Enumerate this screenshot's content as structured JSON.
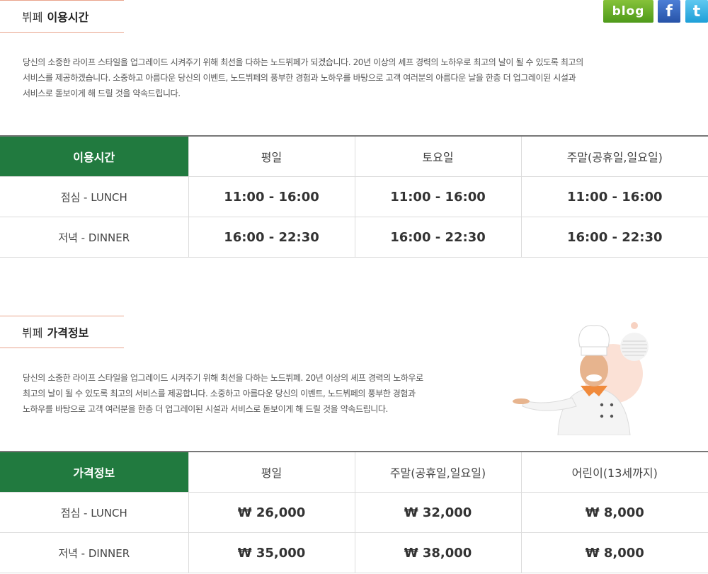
{
  "social": {
    "blog_label": "blog",
    "facebook_label": "f",
    "twitter_label": "t"
  },
  "hours_section": {
    "title_prefix": "뷔페",
    "title_bold": "이용시간",
    "description": [
      "당신의 소중한 라이프 스타일을 업그레이드 시켜주기 위해 최선을 다하는 노드뷔페가 되겠습니다. 20년 이상의 셰프 경력의 노하우로 최고의 날이 될 수 있도록 최고의",
      "서비스를 제공하겠습니다. 소중하고 아름다운 당신의 이벤트, 노드뷔페의 풍부한 경험과 노하우를 바탕으로 고객 여러분의 아름다운 날을 한층 더 업그레이된 시설과",
      "서비스로 돋보이게 해 드릴 것을 약속드립니다."
    ],
    "table": {
      "headers": [
        "이용시간",
        "평일",
        "토요일",
        "주말(공휴일,일요일)"
      ],
      "rows": [
        {
          "label": "점심 - LUNCH",
          "values": [
            "11:00 - 16:00",
            "11:00 - 16:00",
            "11:00 - 16:00"
          ]
        },
        {
          "label": "저녁 - DINNER",
          "values": [
            "16:00 - 22:30",
            "16:00 - 22:30",
            "16:00 - 22:30"
          ]
        }
      ]
    }
  },
  "price_section": {
    "title_prefix": "뷔페",
    "title_bold": "가격정보",
    "description": [
      "당신의 소중한 라이프 스타일을 업그레이드 시켜주기 위해 최선을 다하는 노드뷔페. 20년 이상의 셰프 경력의 노하우로",
      "최고의 날이 될 수 있도록 최고의 서비스를 제공합니다. 소중하고 아름다운 당신의 이벤트, 노드뷔페의 풍부한 경험과",
      "노하우를 바탕으로 고객 여러분을 한층 더 업그레이된 시설과 서비스로 돋보이게 해 드릴 것을 약속드립니다."
    ],
    "table": {
      "headers": [
        "가격정보",
        "평일",
        "주말(공휴일,일요일)",
        "어린이(13세까지)"
      ],
      "rows": [
        {
          "label": "점심 - LUNCH",
          "values": [
            "₩ 26,000",
            "₩ 32,000",
            "₩ 8,000"
          ]
        },
        {
          "label": "저녁 - DINNER",
          "values": [
            "₩ 35,000",
            "₩ 38,000",
            "₩ 8,000"
          ]
        }
      ]
    }
  },
  "colors": {
    "header_green": "#217a3f",
    "title_border": "#e9a48c",
    "blog_green": "#6fb02c",
    "facebook_blue": "#3b5998",
    "twitter_blue": "#33aaee"
  },
  "icons": [
    "blog-icon",
    "facebook-icon",
    "twitter-icon",
    "chef-illustration"
  ]
}
